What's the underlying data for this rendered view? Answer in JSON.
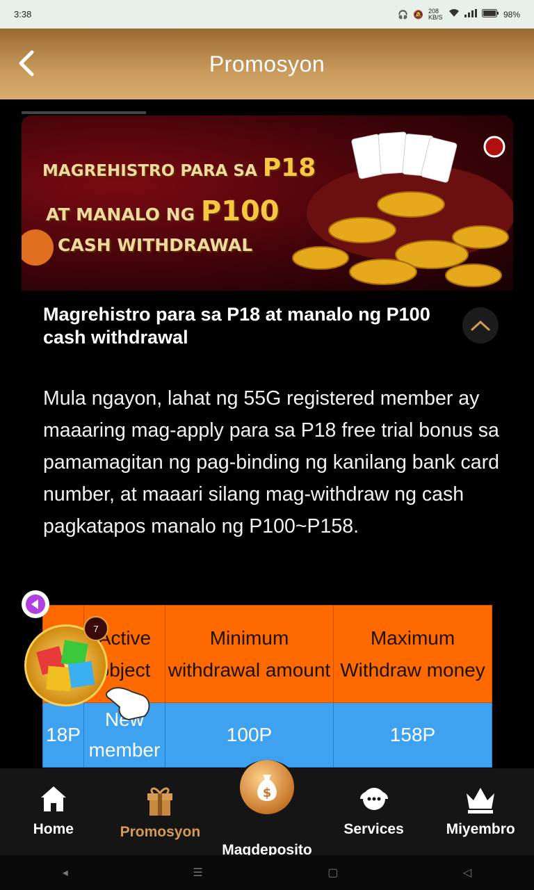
{
  "status_bar": {
    "time": "3:38",
    "net_speed": "208 KB/S",
    "battery": "98%"
  },
  "header": {
    "title": "Promosyon"
  },
  "banner": {
    "line1_text": "MAGREHISTRO PARA SA ",
    "line1_amount": "P18",
    "line2_text": "AT MANALO NG ",
    "line2_amount": "P100",
    "line3_text": "CASH WITHDRAWAL"
  },
  "promo": {
    "title": "Magrehistro para sa P18 at manalo ng P100 cash withdrawal",
    "description": "Mula ngayon, lahat ng 55G registered member ay maaaring mag-apply para sa P18 free trial bonus sa pamamagitan ng pag-binding ng kanilang bank card number, at maaari silang mag-withdraw ng cash pagkatapos manalo ng P100~P158."
  },
  "table": {
    "headers": [
      "",
      "Active object",
      "Minimum withdrawal amount",
      "Maximum Withdraw money"
    ],
    "rows": [
      [
        "18P",
        "New member",
        "100P",
        "158P"
      ]
    ]
  },
  "floating": {
    "badge_count": "7"
  },
  "bottom_nav": {
    "items": [
      {
        "label": "Home",
        "icon": "home-icon"
      },
      {
        "label": "Promosyon",
        "icon": "gift-icon"
      },
      {
        "label": "Magdeposito",
        "icon": "money-bag-icon"
      },
      {
        "label": "Services",
        "icon": "support-icon"
      },
      {
        "label": "Miyembro",
        "icon": "crown-icon"
      }
    ]
  },
  "colors": {
    "header": "#c99a5c",
    "accent": "#d59b52",
    "table_header": "#ff6a00",
    "table_row": "#3ea2f0"
  }
}
